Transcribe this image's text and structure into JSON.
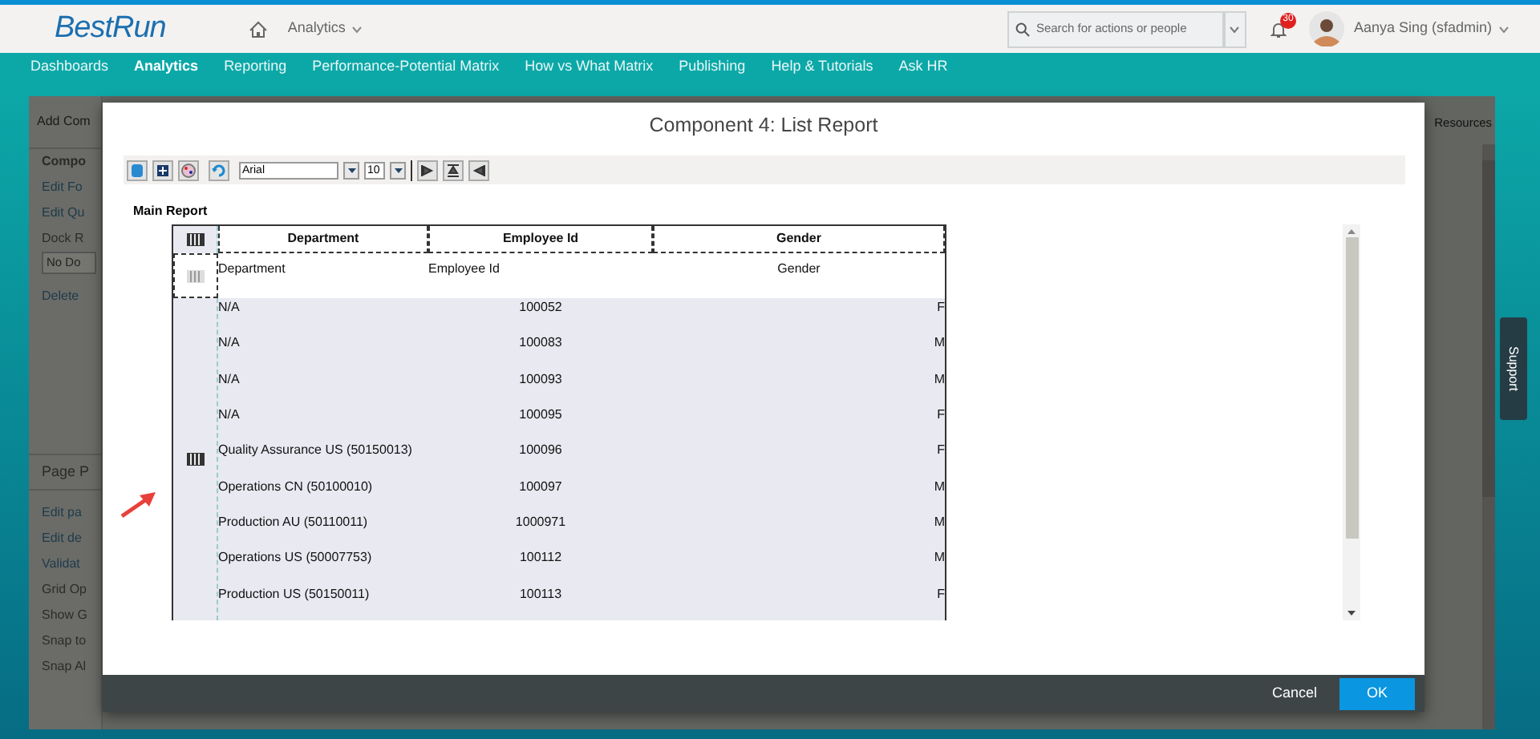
{
  "header": {
    "logo": "BestRun",
    "app_menu": "Analytics",
    "search": {
      "placeholder": "Search for actions or people"
    },
    "notifications": "30",
    "user": "Aanya Sing (sfadmin)"
  },
  "nav": [
    {
      "label": "Dashboards",
      "selected": false
    },
    {
      "label": "Analytics",
      "selected": true
    },
    {
      "label": "Reporting",
      "selected": false
    },
    {
      "label": "Performance-Potential Matrix",
      "selected": false
    },
    {
      "label": "How vs What Matrix",
      "selected": false
    },
    {
      "label": "Publishing",
      "selected": false
    },
    {
      "label": "Help & Tutorials",
      "selected": false
    },
    {
      "label": "Ask HR",
      "selected": false
    }
  ],
  "side_panel": {
    "header": "Add Com",
    "items": [
      {
        "label": "Compo",
        "kind": "heading"
      },
      {
        "label": "Edit Fo",
        "kind": "link"
      },
      {
        "label": "Edit Qu",
        "kind": "link"
      },
      {
        "label": "Dock R",
        "kind": "label"
      },
      {
        "label": "No Do",
        "kind": "select"
      },
      {
        "label": "Delete",
        "kind": "link"
      }
    ],
    "section": "Page P",
    "section_items": [
      {
        "label": "Edit pa",
        "kind": "link"
      },
      {
        "label": "Edit de",
        "kind": "link"
      },
      {
        "label": "Validat",
        "kind": "link"
      },
      {
        "label": "Grid Op",
        "kind": "label"
      },
      {
        "label": "Show G",
        "kind": "label"
      },
      {
        "label": "Snap to",
        "kind": "label"
      },
      {
        "label": "Snap Al",
        "kind": "label"
      }
    ],
    "right_tab": "Resources"
  },
  "support_tab": "Support",
  "dialog": {
    "title": "Component 4: List Report",
    "toolbar": {
      "font": "Arial",
      "size": "10"
    },
    "report_title": "Main Report",
    "table": {
      "header_cells": [
        "Department",
        "Employee Id",
        "Gender"
      ],
      "column_labels": [
        "Department",
        "Employee Id",
        "Gender"
      ],
      "rows": [
        [
          "N/A",
          "100052",
          "F"
        ],
        [
          "N/A",
          "100083",
          "M"
        ],
        [
          "N/A",
          "100093",
          "M"
        ],
        [
          "N/A",
          "100095",
          "F"
        ],
        [
          "Quality Assurance US (50150013)",
          "100096",
          "F"
        ],
        [
          "Operations CN (50100010)",
          "100097",
          "M"
        ],
        [
          "Production AU (50110011)",
          "1000971",
          "M"
        ],
        [
          "Operations US (50007753)",
          "100112",
          "M"
        ],
        [
          "Production US (50150011)",
          "100113",
          "F"
        ]
      ]
    },
    "buttons": [
      {
        "label": "Cancel",
        "kind": "link"
      },
      {
        "label": "OK",
        "kind": "primary"
      }
    ]
  }
}
